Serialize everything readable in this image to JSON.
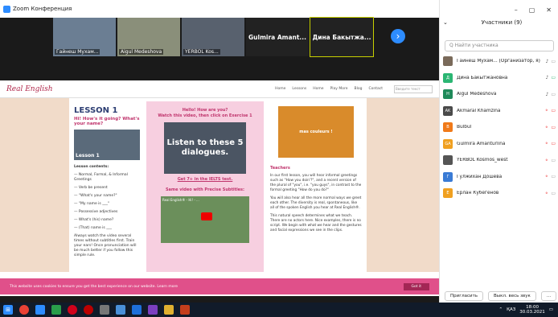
{
  "window": {
    "title": "Zoom Конференция"
  },
  "videos": [
    {
      "name": "Гайнеш Мухам...",
      "bg": "#6b7e93"
    },
    {
      "name": "Aigul Medeshova",
      "bg": "#8a8f7a"
    },
    {
      "name": "YERBOL Kos...",
      "bg": "#58616e"
    },
    {
      "name": "Gulmira Amant...",
      "type": "name"
    },
    {
      "name": "Дина Бакытжа...",
      "type": "name",
      "active": true
    }
  ],
  "site": {
    "logo": "Real English",
    "nav": [
      "Home",
      "Lessons",
      "Home",
      "Play More",
      "Blog",
      "Contact"
    ],
    "search": "Введите текст",
    "col1": {
      "title": "LESSON 1",
      "subtitle": "Hi! How's it going? What's your name?",
      "pic_label": "Lesson 1",
      "contents_title": "Lesson contents:",
      "items": [
        "— Normal, Formal, & Informal Greetings",
        "— Verb be present",
        "— \"What's your name?\"",
        "— \"My name is ___\"",
        "— Possessive adjectives",
        "— What's (his) name?",
        "— (That) name is ___"
      ],
      "note": "Always watch the video several times without subtitles first. Train your ears! Once pronunciation will be much better if you follow this simple rule."
    },
    "col2": {
      "hello": "Hello! How are you?",
      "watch": "Watch this video, then click on Exercise 1",
      "pic_text": "Listen to these 5 dialogues.",
      "ielts": "Get 7+ in the IELTS test.",
      "same": "Same video with Precise Subtitles:",
      "video_title": "Real English® - Hi! - ..."
    },
    "col3": {
      "ad": "mas couleurs !",
      "teachers": "Teachers",
      "t1": "In our first lesson, you will hear informal greetings such as \"How you doin'?\", and a recent version of the plural of \"you\", i.e. \"you guys\", in contrast to the formal greeting \"How do you do?\"",
      "t2": "You will also hear all the more normal ways we greet each other. The diversity is real, spontaneous, like all of the spoken English you hear at Real English®.",
      "t3": "This natural speech determines what we teach. There are no actors here. Nice examples, there is no script. We begin with what we hear and the gestures and facial expressions we see in the clips."
    },
    "cookie": {
      "text": "This website uses cookies to ensure you get the best experience on our website. Learn more",
      "ok": "Got it"
    }
  },
  "panel": {
    "window_controls": [
      "–",
      "▢",
      "✕"
    ],
    "title": "Участники (9)",
    "search_placeholder": "Q Найти участника",
    "participants": [
      {
        "name": "Гайнеш Мухам... (Организатор, я)",
        "avatar": "photo",
        "color": "#7a6a5a",
        "mic": "on",
        "cam": "off"
      },
      {
        "name": "Дина Бакытжановна",
        "avatar": "Д",
        "color": "#2bb673",
        "mic": "on",
        "cam": "on"
      },
      {
        "name": "Aigul Medeshova",
        "avatar": "H",
        "color": "#1f8a5a",
        "mic": "on",
        "cam": "off"
      },
      {
        "name": "Akmaral Khamzina",
        "avatar": "AK",
        "color": "#4a4a4a",
        "mic": "muted",
        "cam": "muted"
      },
      {
        "name": "Bulbul",
        "avatar": "B",
        "color": "#f07a1a",
        "mic": "muted",
        "cam": "muted"
      },
      {
        "name": "Gulmira Amanturlina",
        "avatar": "GA",
        "color": "#f0a020",
        "mic": "muted",
        "cam": "muted"
      },
      {
        "name": "YERBOL Kosmos_west",
        "avatar": "photo",
        "color": "#555",
        "mic": "muted",
        "cam": "off"
      },
      {
        "name": "Гулжихан Дошева",
        "avatar": "Г",
        "color": "#3a7bd5",
        "mic": "muted",
        "cam": "off"
      },
      {
        "name": "Ерлан Кубегенов",
        "avatar": "Е",
        "color": "#f0a020",
        "mic": "muted",
        "cam": "off"
      }
    ],
    "invite": "Пригласить",
    "mute_all": "Выкл. весь звук",
    "more": "..."
  },
  "taskbar": {
    "lang": "ҚАЗ",
    "time": "18:00",
    "date": "30.03.2021"
  }
}
